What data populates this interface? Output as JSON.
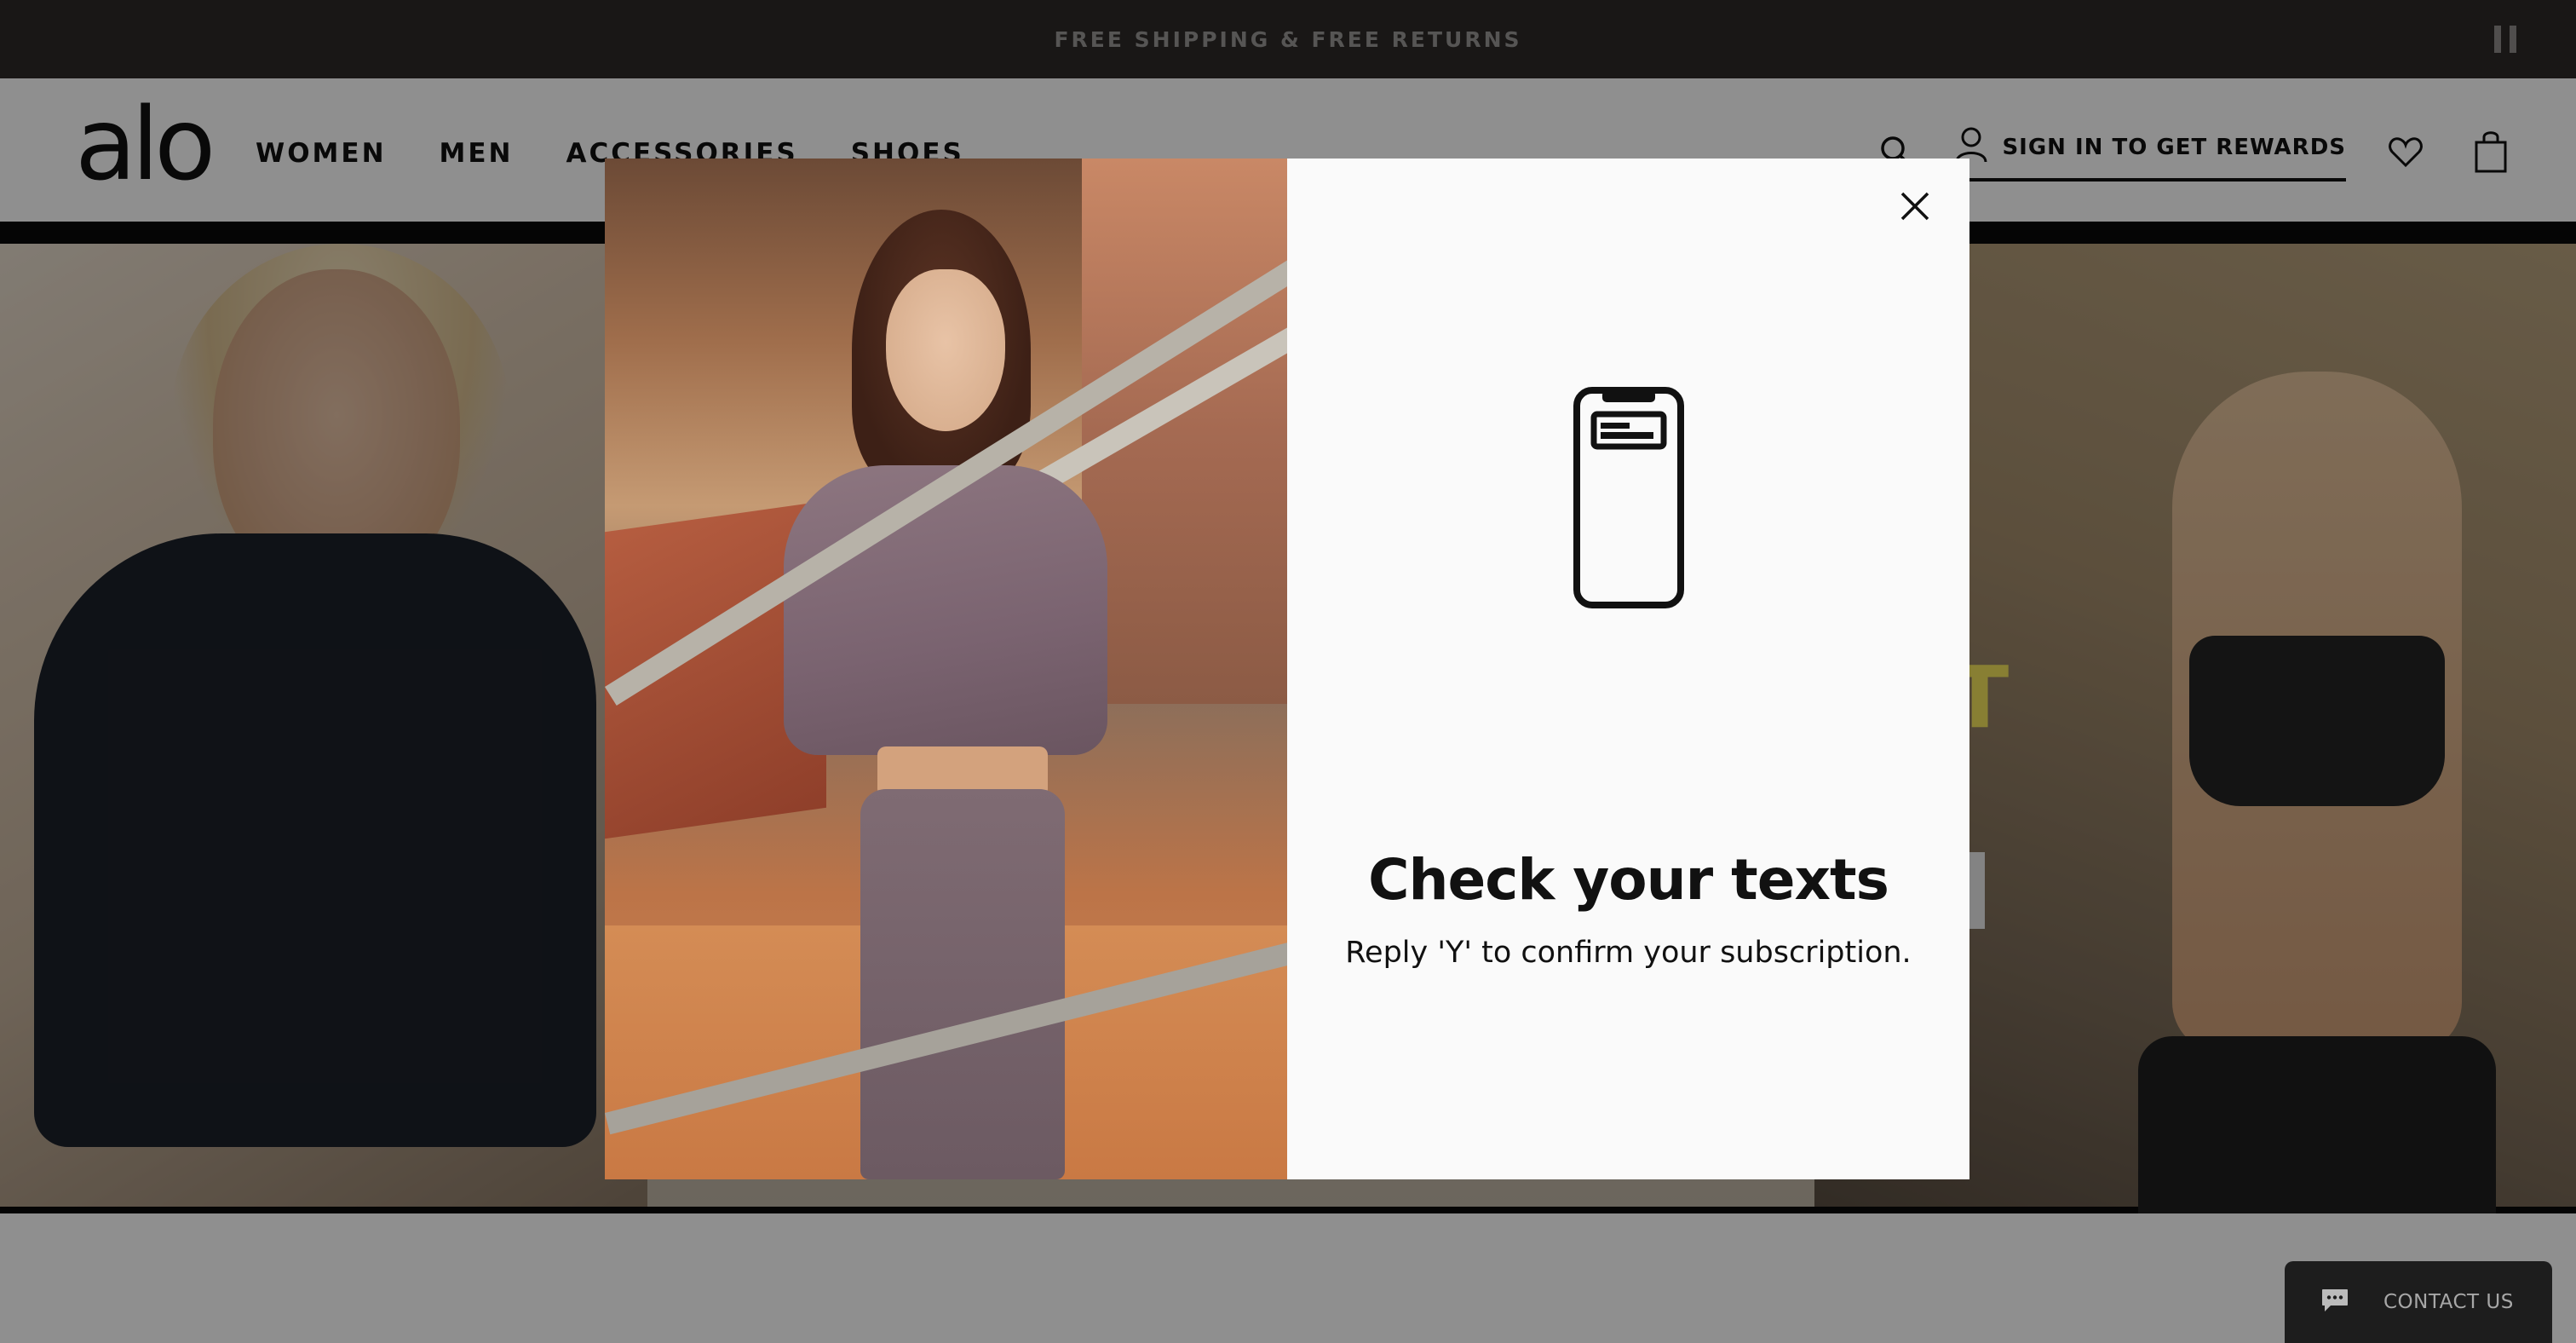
{
  "announcement": {
    "text": "FREE SHIPPING & FREE RETURNS"
  },
  "header": {
    "logo": "alo",
    "nav": [
      "WOMEN",
      "MEN",
      "ACCESSORIES",
      "SHOES"
    ],
    "signin_label": "SIGN IN TO GET REWARDS",
    "icons": [
      "search-icon",
      "user-icon",
      "heart-icon",
      "bag-icon"
    ]
  },
  "modal": {
    "heading": "Check your texts",
    "subtext": "Reply 'Y' to confirm your subscription.",
    "icon": "phone-icon"
  },
  "contact": {
    "label": "CONTACT US",
    "icon": "chat-icon"
  },
  "colors": {
    "announcement_bg": "#2d2a28",
    "modal_bg": "#fafafa",
    "overlay": "rgba(0,0,0,0.44)",
    "contact_bg": "#1d1d1d",
    "hero_accent": "#f2e35c"
  }
}
